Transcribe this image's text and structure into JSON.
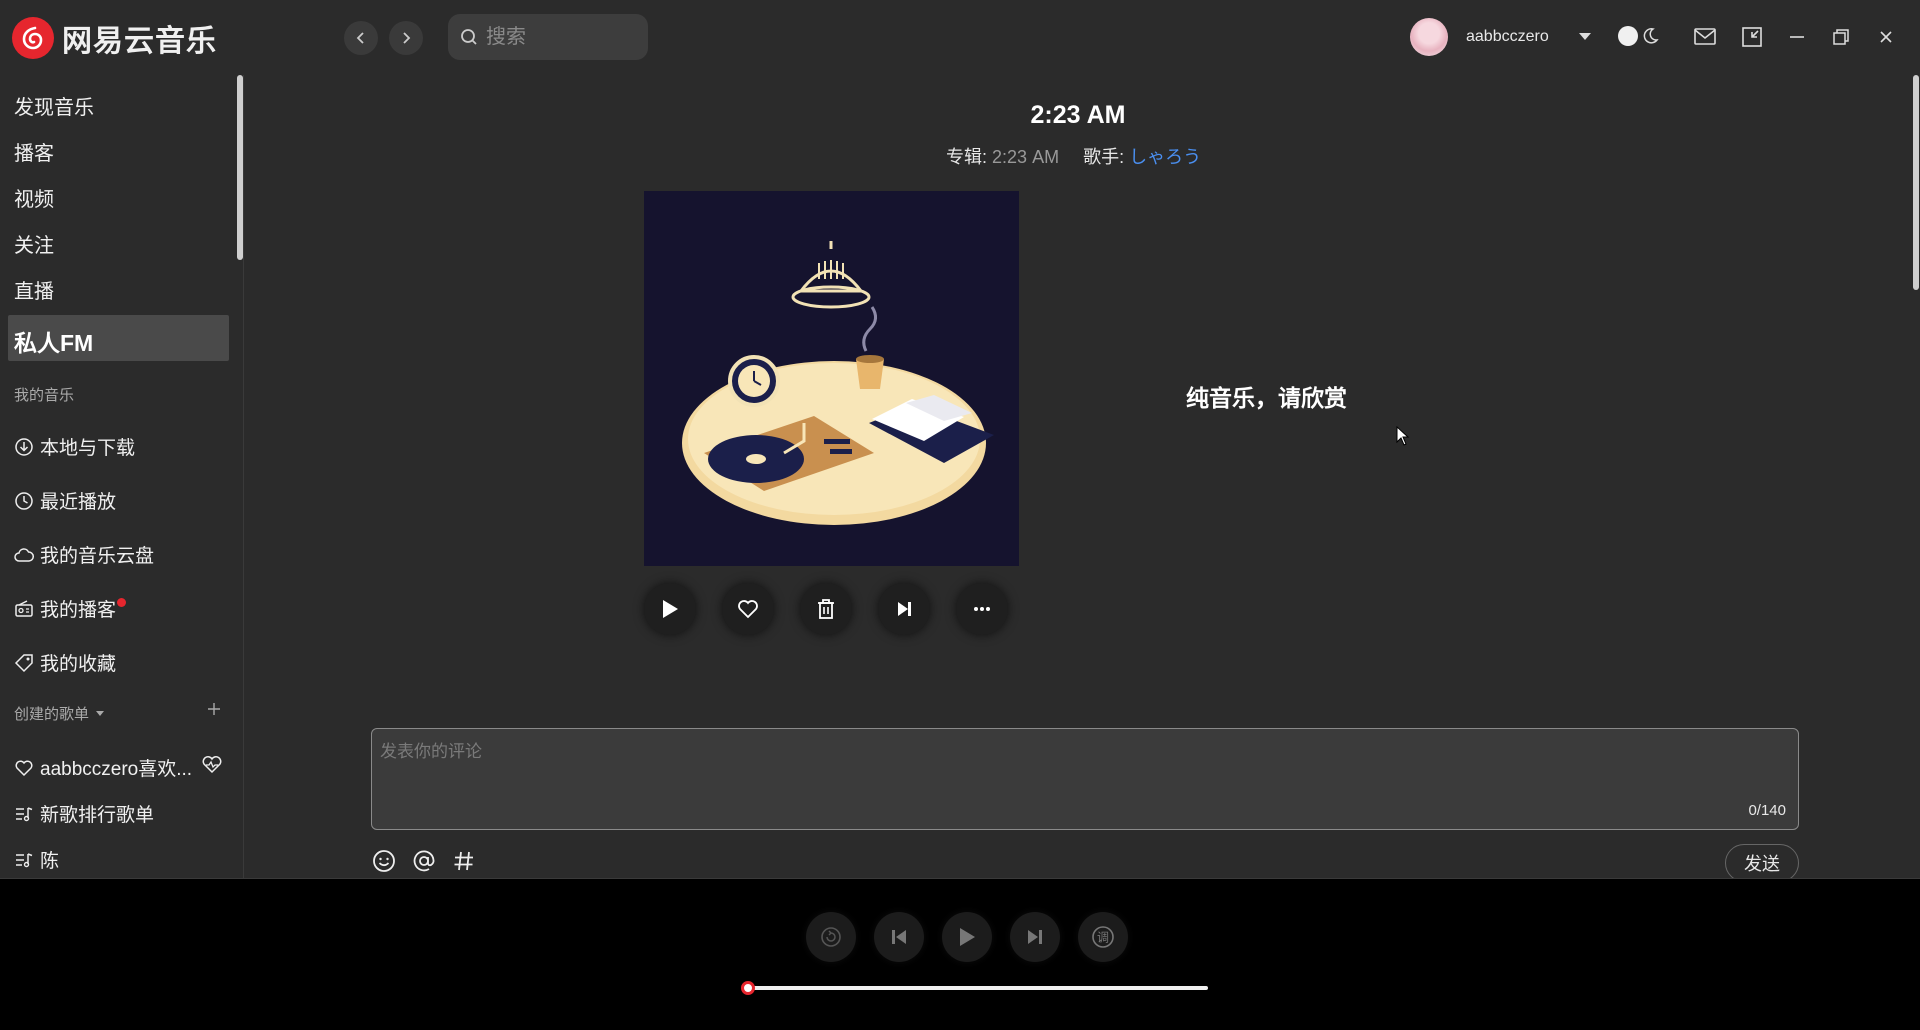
{
  "app": {
    "name": "网易云音乐"
  },
  "header": {
    "search_placeholder": "搜索",
    "username": "aabbcczero"
  },
  "sidebar": {
    "nav": [
      "发现音乐",
      "播客",
      "视频",
      "关注",
      "直播"
    ],
    "active": "私人FM",
    "my_music_label": "我的音乐",
    "library": [
      "本地与下载",
      "最近播放",
      "我的音乐云盘",
      "我的播客",
      "我的收藏"
    ],
    "created_label": "创建的歌单",
    "playlists": [
      "aabbcczero喜欢...",
      "新歌排行歌单",
      "陈"
    ]
  },
  "song": {
    "title": "2:23 AM",
    "album_label": "专辑:",
    "album": "2:23 AM",
    "artist_label": "歌手:",
    "artist": "しゃろう",
    "lyric": "纯音乐，请欣赏"
  },
  "comment": {
    "placeholder": "发表你的评论",
    "counter": "0/140",
    "send": "发送"
  },
  "player": {
    "progress": 0.0
  },
  "colors": {
    "brand": "#e6262e",
    "link": "#4a8ff0"
  }
}
